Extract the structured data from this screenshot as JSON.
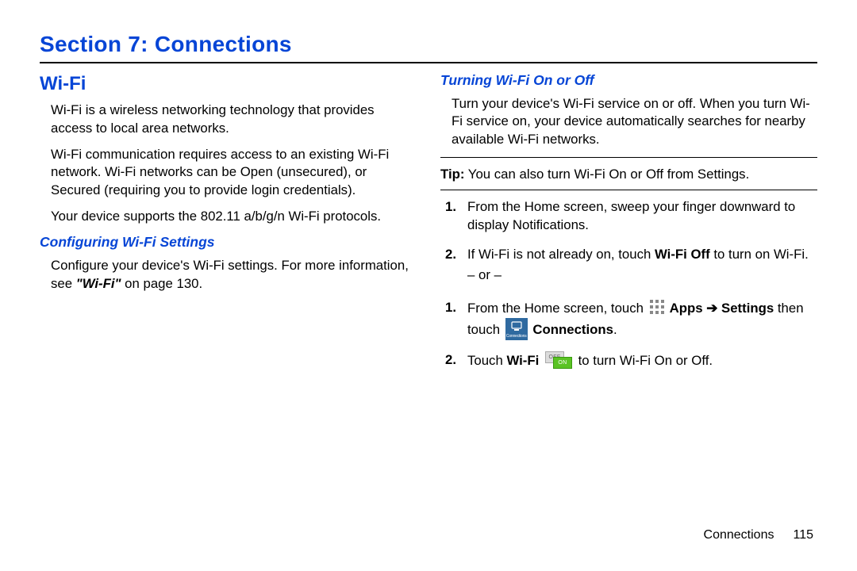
{
  "section_title": "Section 7: Connections",
  "left": {
    "h2": "Wi-Fi",
    "p1": "Wi-Fi is a wireless networking technology that provides access to local area networks.",
    "p2": "Wi-Fi communication requires access to an existing Wi-Fi network. Wi-Fi networks can be Open (unsecured), or Secured (requiring you to provide login credentials).",
    "p3": "Your device supports the 802.11 a/b/g/n Wi-Fi protocols.",
    "h3": "Configuring Wi-Fi Settings",
    "p4a": "Configure your device's Wi-Fi settings. For more information, see ",
    "p4b": "\"Wi-Fi\"",
    "p4c": " on page 130."
  },
  "right": {
    "h3": "Turning Wi-Fi On or Off",
    "p1": "Turn your device's Wi-Fi service on or off. When you turn Wi-Fi service on, your device automatically searches for nearby available Wi-Fi networks.",
    "tip_label": "Tip:",
    "tip_body": " You can also turn Wi-Fi On or Off from Settings.",
    "listA": {
      "s1": "From the Home screen, sweep your finger downward to display Notifications.",
      "s2a": "If Wi-Fi is not already on, touch ",
      "s2b": "Wi-Fi Off",
      "s2c": " to turn on Wi-Fi.",
      "or": "– or –"
    },
    "listB": {
      "s1a": "From the Home screen, touch ",
      "s1_apps": " Apps ",
      "arrow": "➔",
      "s1_settings": "Settings",
      "s1_then": " then touch ",
      "conn_label": "Connections",
      "s1_conn": " Connections",
      "s1_end": ".",
      "s2a": "Touch ",
      "s2_wifi": "Wi-Fi ",
      "toggle_off": "OFF",
      "toggle_on": "ON",
      "s2b": " to turn Wi-Fi On or Off."
    }
  },
  "footer": {
    "label": "Connections",
    "page": "115"
  }
}
